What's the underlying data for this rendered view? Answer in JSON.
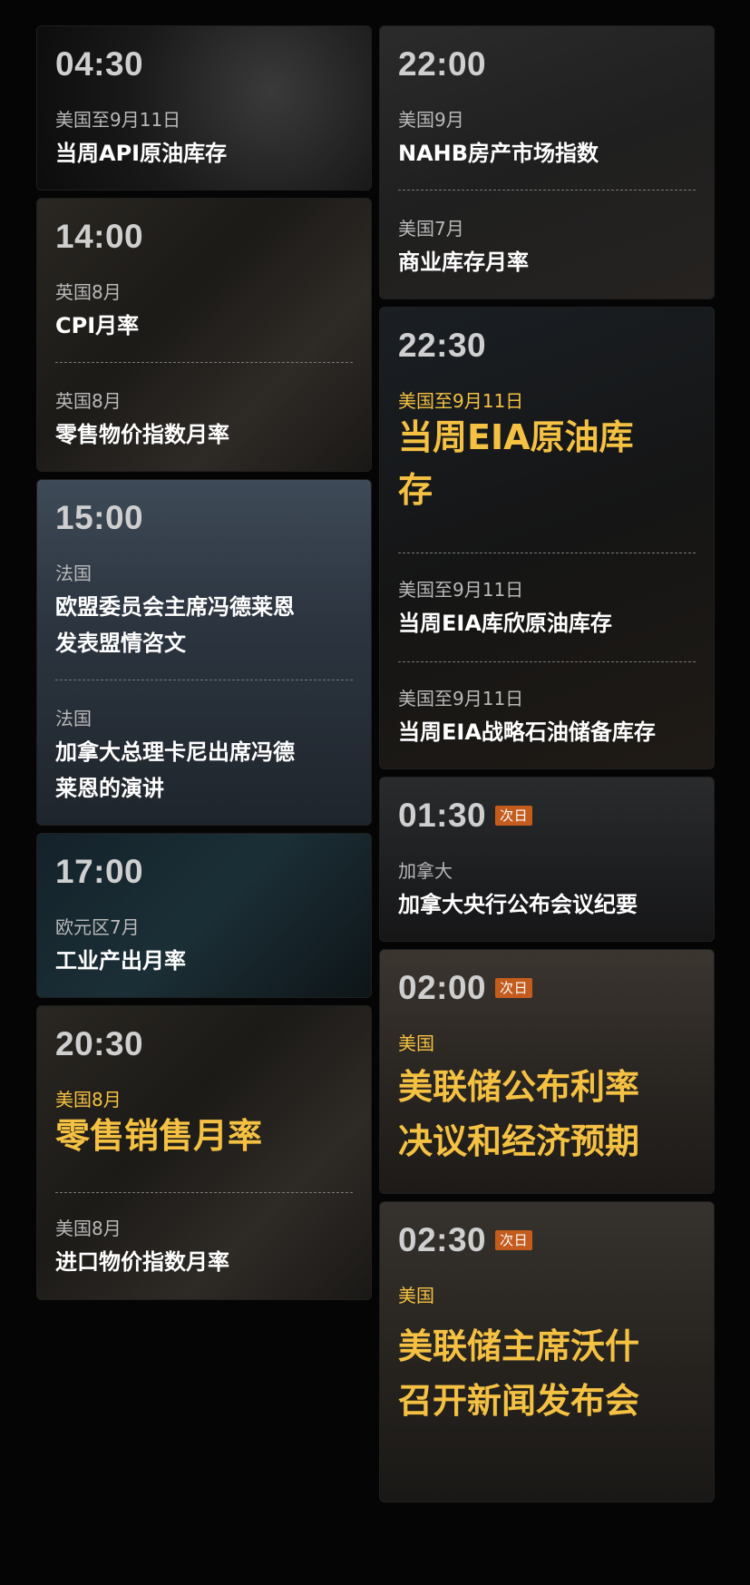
{
  "left": [
    {
      "time": "04:30",
      "events": [
        {
          "region": "美国至9月11日",
          "title": "当周API原油库存"
        }
      ]
    },
    {
      "time": "14:00",
      "events": [
        {
          "region": "英国8月",
          "title": "CPI月率"
        },
        {
          "region": "英国8月",
          "title": "零售物价指数月率"
        }
      ]
    },
    {
      "time": "15:00",
      "events": [
        {
          "region": "法国",
          "title_line1": "欧盟委员会主席冯德莱恩",
          "title_line2": "发表盟情咨文"
        },
        {
          "region": "法国",
          "title_line1": "加拿大总理卡尼出席冯德",
          "title_line2": "莱恩的演讲"
        }
      ]
    },
    {
      "time": "17:00",
      "events": [
        {
          "region": "欧元区7月",
          "title": "工业产出月率"
        }
      ]
    },
    {
      "time": "20:30",
      "events": [
        {
          "region": "美国8月",
          "title": "零售销售月率"
        },
        {
          "region": "美国8月",
          "title": "进口物价指数月率"
        }
      ]
    }
  ],
  "right": [
    {
      "time": "22:00",
      "events": [
        {
          "region": "美国9月",
          "title": "NAHB房产市场指数"
        },
        {
          "region": "美国7月",
          "title": "商业库存月率"
        }
      ]
    },
    {
      "time": "22:30",
      "events": [
        {
          "region": "美国至9月11日",
          "title_line1": "当周EIA原油库",
          "title_line2": "存"
        },
        {
          "region": "美国至9月11日",
          "title": "当周EIA库欣原油库存"
        },
        {
          "region": "美国至9月11日",
          "title": "当周EIA战略石油储备库存"
        }
      ]
    },
    {
      "time": "01:30",
      "badge": "次日",
      "events": [
        {
          "region": "加拿大",
          "title": "加拿大央行公布会议纪要"
        }
      ]
    },
    {
      "time": "02:00",
      "badge": "次日",
      "events": [
        {
          "region": "美国",
          "title_line1": "美联储公布利率",
          "title_line2": "决议和经济预期"
        }
      ]
    },
    {
      "time": "02:30",
      "badge": "次日",
      "events": [
        {
          "region": "美国",
          "title_line1": "美联储主席沃什",
          "title_line2": "召开新闻发布会"
        }
      ]
    }
  ],
  "colors": {
    "highlight": "#f5c142",
    "badge": "#c45c1e",
    "background": "#050505"
  }
}
